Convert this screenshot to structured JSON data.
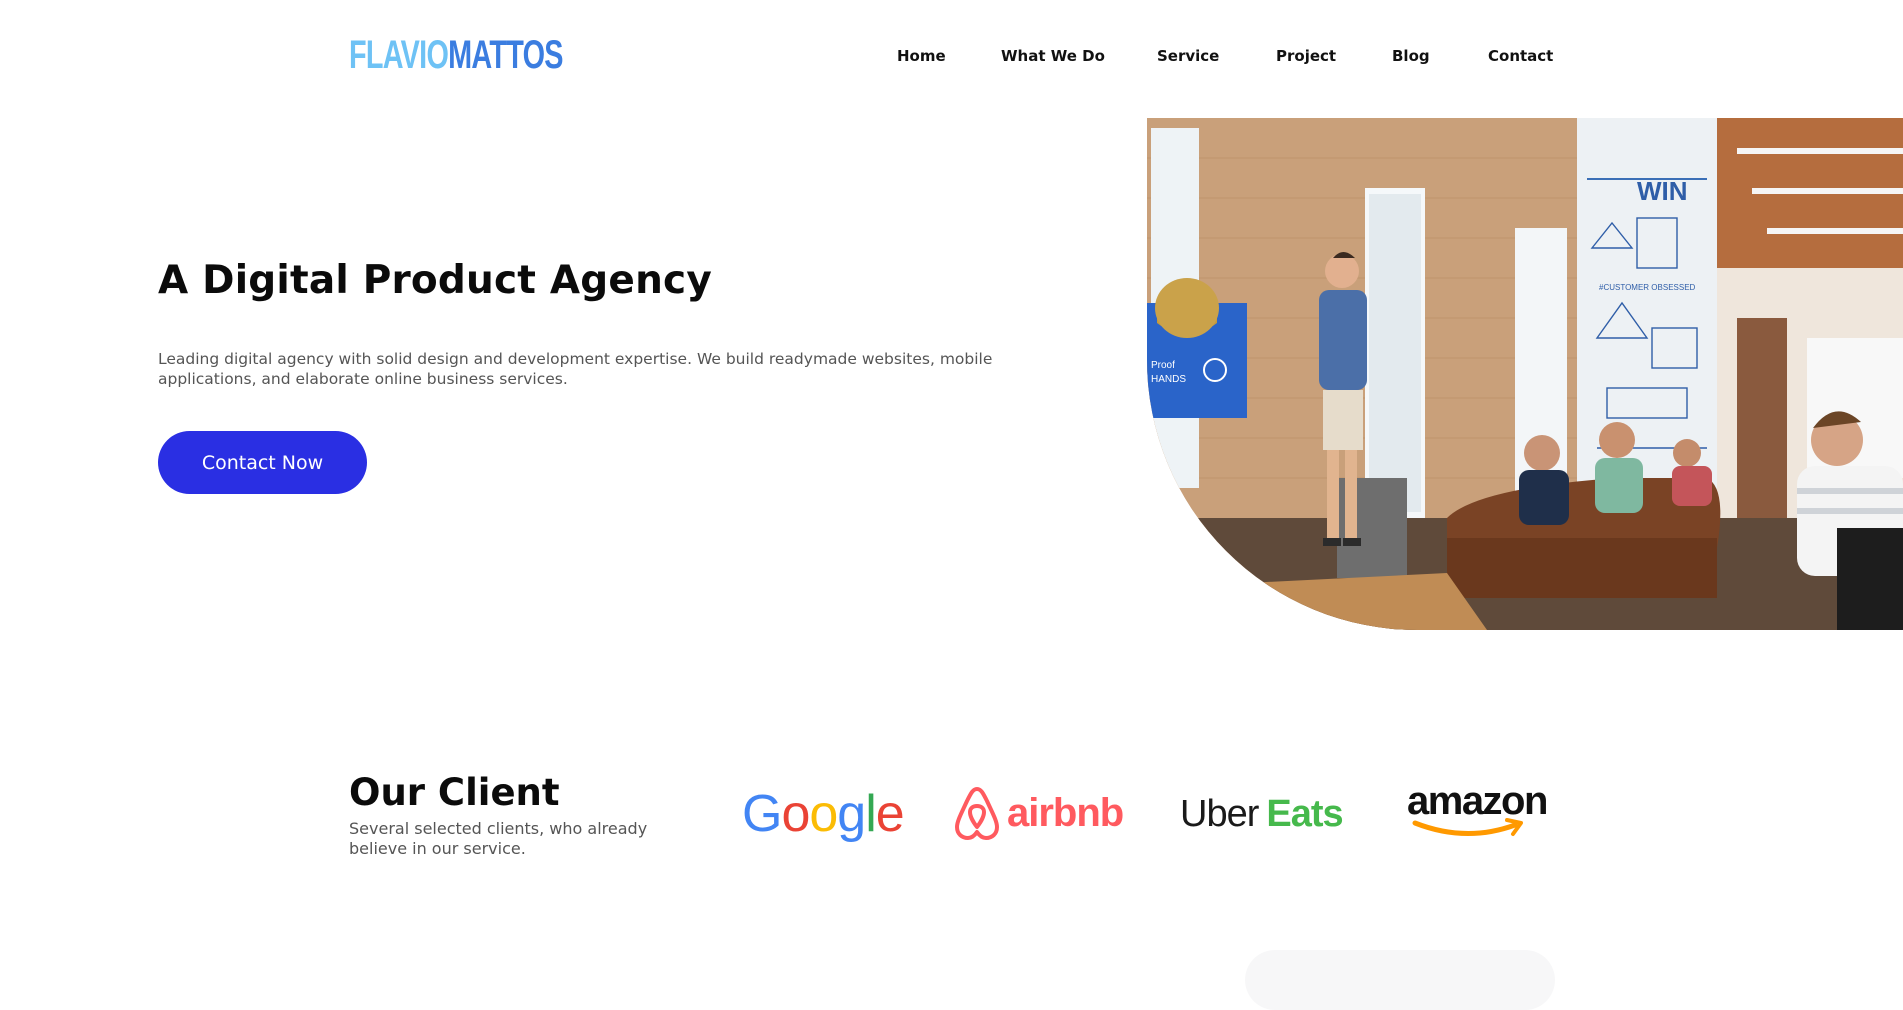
{
  "header": {
    "logo_part1": "FLAVIO",
    "logo_part2": "MATTOS",
    "logo_colors": {
      "part1": "#6ec2f5",
      "part2": "#3b7de0"
    },
    "nav": [
      "Home",
      "What We Do",
      "Service",
      "Project",
      "Blog",
      "Contact"
    ]
  },
  "hero": {
    "title": "A Digital Product Agency",
    "description": "Leading digital agency with solid design and development expertise. We build readymade websites, mobile applications, and elaborate online business services.",
    "cta_label": "Contact Now",
    "cta_color": "#2a2fe3",
    "image_signs": {
      "win": "WIN",
      "customer": "#CUSTOMER OBSESSED",
      "screen1": "Proof",
      "screen2": "HANDS"
    }
  },
  "clients": {
    "title": "Our Client",
    "description": "Several selected clients, who already believe in our service.",
    "logos": {
      "google": [
        "G",
        "o",
        "o",
        "g",
        "l",
        "e"
      ],
      "google_colors": [
        "#4285F4",
        "#EA4335",
        "#FBBC05",
        "#4285F4",
        "#34A853",
        "#EA4335"
      ],
      "airbnb": "airbnb",
      "airbnb_icon": "airbnb-belo-icon",
      "uber": "Uber",
      "eats": "Eats",
      "amazon": "amazon",
      "amazon_icon": "amazon-smile-arrow-icon"
    }
  }
}
